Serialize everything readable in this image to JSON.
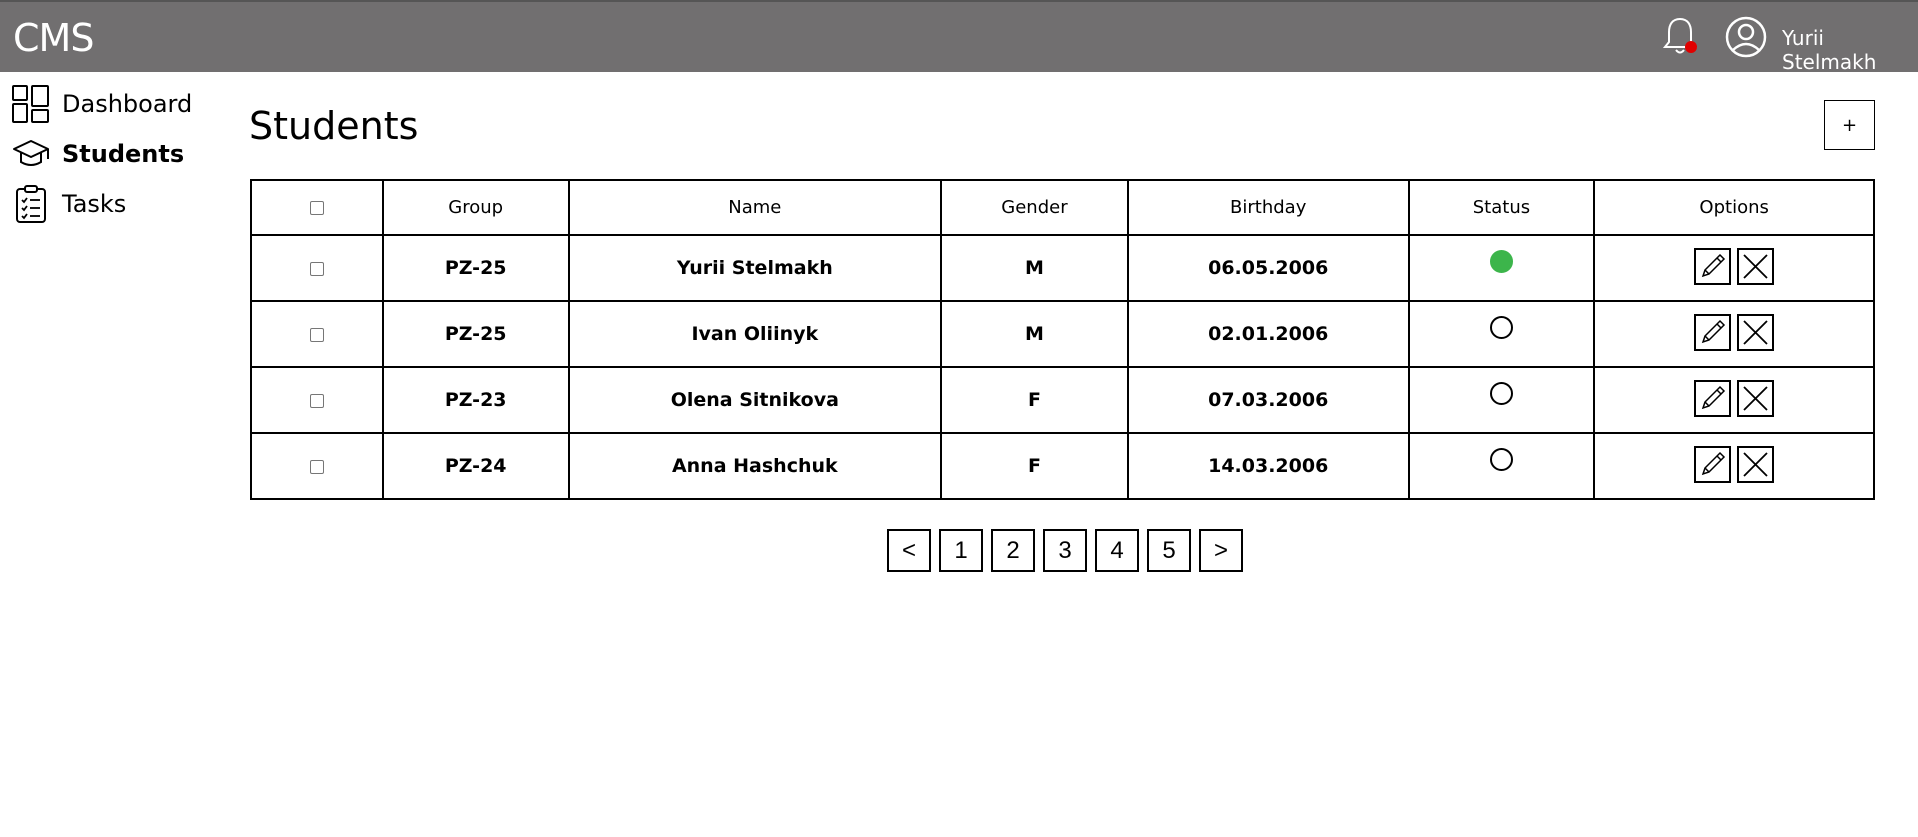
{
  "header": {
    "brand": "CMS",
    "notification_dot_color": "#e00000",
    "user_name": "Yurii Stelmakh"
  },
  "sidebar": {
    "items": [
      {
        "label": "Dashboard",
        "icon": "dashboard-icon",
        "active": false
      },
      {
        "label": "Students",
        "icon": "graduation-cap-icon",
        "active": true
      },
      {
        "label": "Tasks",
        "icon": "clipboard-list-icon",
        "active": false
      }
    ]
  },
  "main": {
    "title": "Students",
    "add_label": "+",
    "table": {
      "columns": [
        "Group",
        "Name",
        "Gender",
        "Birthday",
        "Status",
        "Options"
      ],
      "rows": [
        {
          "group": "PZ-25",
          "name": "Yurii Stelmakh",
          "gender": "M",
          "birthday": "06.05.2006",
          "status": "active"
        },
        {
          "group": "PZ-25",
          "name": "Ivan Oliinyk",
          "gender": "M",
          "birthday": "02.01.2006",
          "status": "inactive"
        },
        {
          "group": "PZ-23",
          "name": "Olena Sitnikova",
          "gender": "F",
          "birthday": "07.03.2006",
          "status": "inactive"
        },
        {
          "group": "PZ-24",
          "name": "Anna Hashchuk",
          "gender": "F",
          "birthday": "14.03.2006",
          "status": "inactive"
        }
      ]
    },
    "pagination": {
      "prev": "<",
      "pages": [
        "1",
        "2",
        "3",
        "4",
        "5"
      ],
      "next": ">"
    }
  },
  "colors": {
    "header_bg": "#716f70",
    "status_active": "#3cb54b"
  }
}
